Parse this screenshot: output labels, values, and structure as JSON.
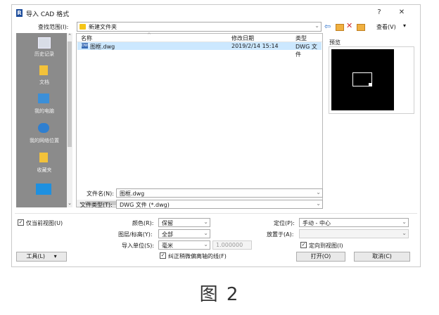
{
  "window": {
    "app_icon": "R",
    "title": "导入 CAD 格式",
    "help": "?",
    "close": "✕"
  },
  "lookin": {
    "label": "查找范围(I):",
    "folder": "新建文件夹",
    "view_label": "查看(V)"
  },
  "places": [
    {
      "label": "历史记录",
      "icon": "history-icon"
    },
    {
      "label": "文档",
      "icon": "documents-icon"
    },
    {
      "label": "我的电脑",
      "icon": "computer-icon"
    },
    {
      "label": "我的网络位置",
      "icon": "network-icon"
    },
    {
      "label": "收藏夹",
      "icon": "favorites-icon"
    }
  ],
  "files": {
    "headers": {
      "name": "名称",
      "date": "修改日期",
      "type": "类型"
    },
    "rows": [
      {
        "name": "图框.dwg",
        "date": "2019/2/14 15:14",
        "type": "DWG 文件"
      }
    ]
  },
  "preview": {
    "label": "预览"
  },
  "filename": {
    "label": "文件名(N):",
    "value": "图框.dwg"
  },
  "filetype": {
    "label": "文件类型(T):",
    "value": "DWG 文件  (*.dwg)"
  },
  "options": {
    "current_view_only": "仅当前视图(U)",
    "color_label": "颜色(R):",
    "color_value": "保留",
    "layers_label": "图层/标高(Y):",
    "layers_value": "全部",
    "units_label": "导入单位(S):",
    "units_value": "毫米",
    "units_factor": "1.000000",
    "correct_lines": "纠正稍微偏离轴的线(F)",
    "position_label": "定位(P):",
    "position_value": "手动 - 中心",
    "place_at_label": "放置于(A):",
    "place_at_value": "",
    "orient_to_view": "定向到视图(I)"
  },
  "buttons": {
    "tools": "工具(L)",
    "open": "打开(O)",
    "cancel": "取消(C)"
  },
  "caption": "图 2",
  "colors": {
    "title_icon": "#1f4e9c",
    "selection": "#cce8ff",
    "places_bg": "#8b8b8b",
    "folder": "#f5c518",
    "back_arrow": "#2a6fc9",
    "delete": "#d03030"
  }
}
